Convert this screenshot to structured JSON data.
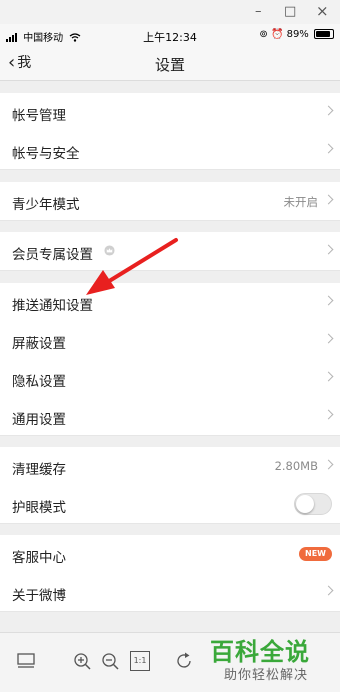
{
  "window": {
    "minimize": "–",
    "maximize": "□",
    "close": "×"
  },
  "status_bar": {
    "carrier": "中国移动",
    "time": "上午12:34",
    "battery": "89%",
    "battery_level": 0.89
  },
  "nav": {
    "back_label": "我",
    "title": "设置"
  },
  "sections": [
    {
      "items": [
        {
          "label": "帐号管理"
        },
        {
          "label": "帐号与安全"
        }
      ]
    },
    {
      "items": [
        {
          "label": "青少年模式",
          "value": "未开启"
        }
      ]
    },
    {
      "items": [
        {
          "label": "会员专属设置",
          "icon": "crown-icon"
        }
      ]
    },
    {
      "items": [
        {
          "label": "推送通知设置"
        },
        {
          "label": "屏蔽设置"
        },
        {
          "label": "隐私设置"
        },
        {
          "label": "通用设置"
        }
      ]
    },
    {
      "items": [
        {
          "label": "清理缓存",
          "value": "2.80MB"
        },
        {
          "label": "护眼模式",
          "toggle": false
        }
      ]
    },
    {
      "items": [
        {
          "label": "客服中心",
          "badge": "NEW"
        },
        {
          "label": "关于微博"
        }
      ]
    }
  ],
  "toolbar": {
    "icons": [
      "layout-icon",
      "zoom-in-icon",
      "zoom-out-icon",
      "actual-size-icon",
      "rotate-icon"
    ],
    "actual_size_label": "1:1"
  },
  "watermark": {
    "title": "百科全说",
    "subtitle": "助你轻松解决"
  },
  "colors": {
    "arrow": "#e8201f",
    "badge": "#f06b3d",
    "watermark": "#3aa83a"
  }
}
